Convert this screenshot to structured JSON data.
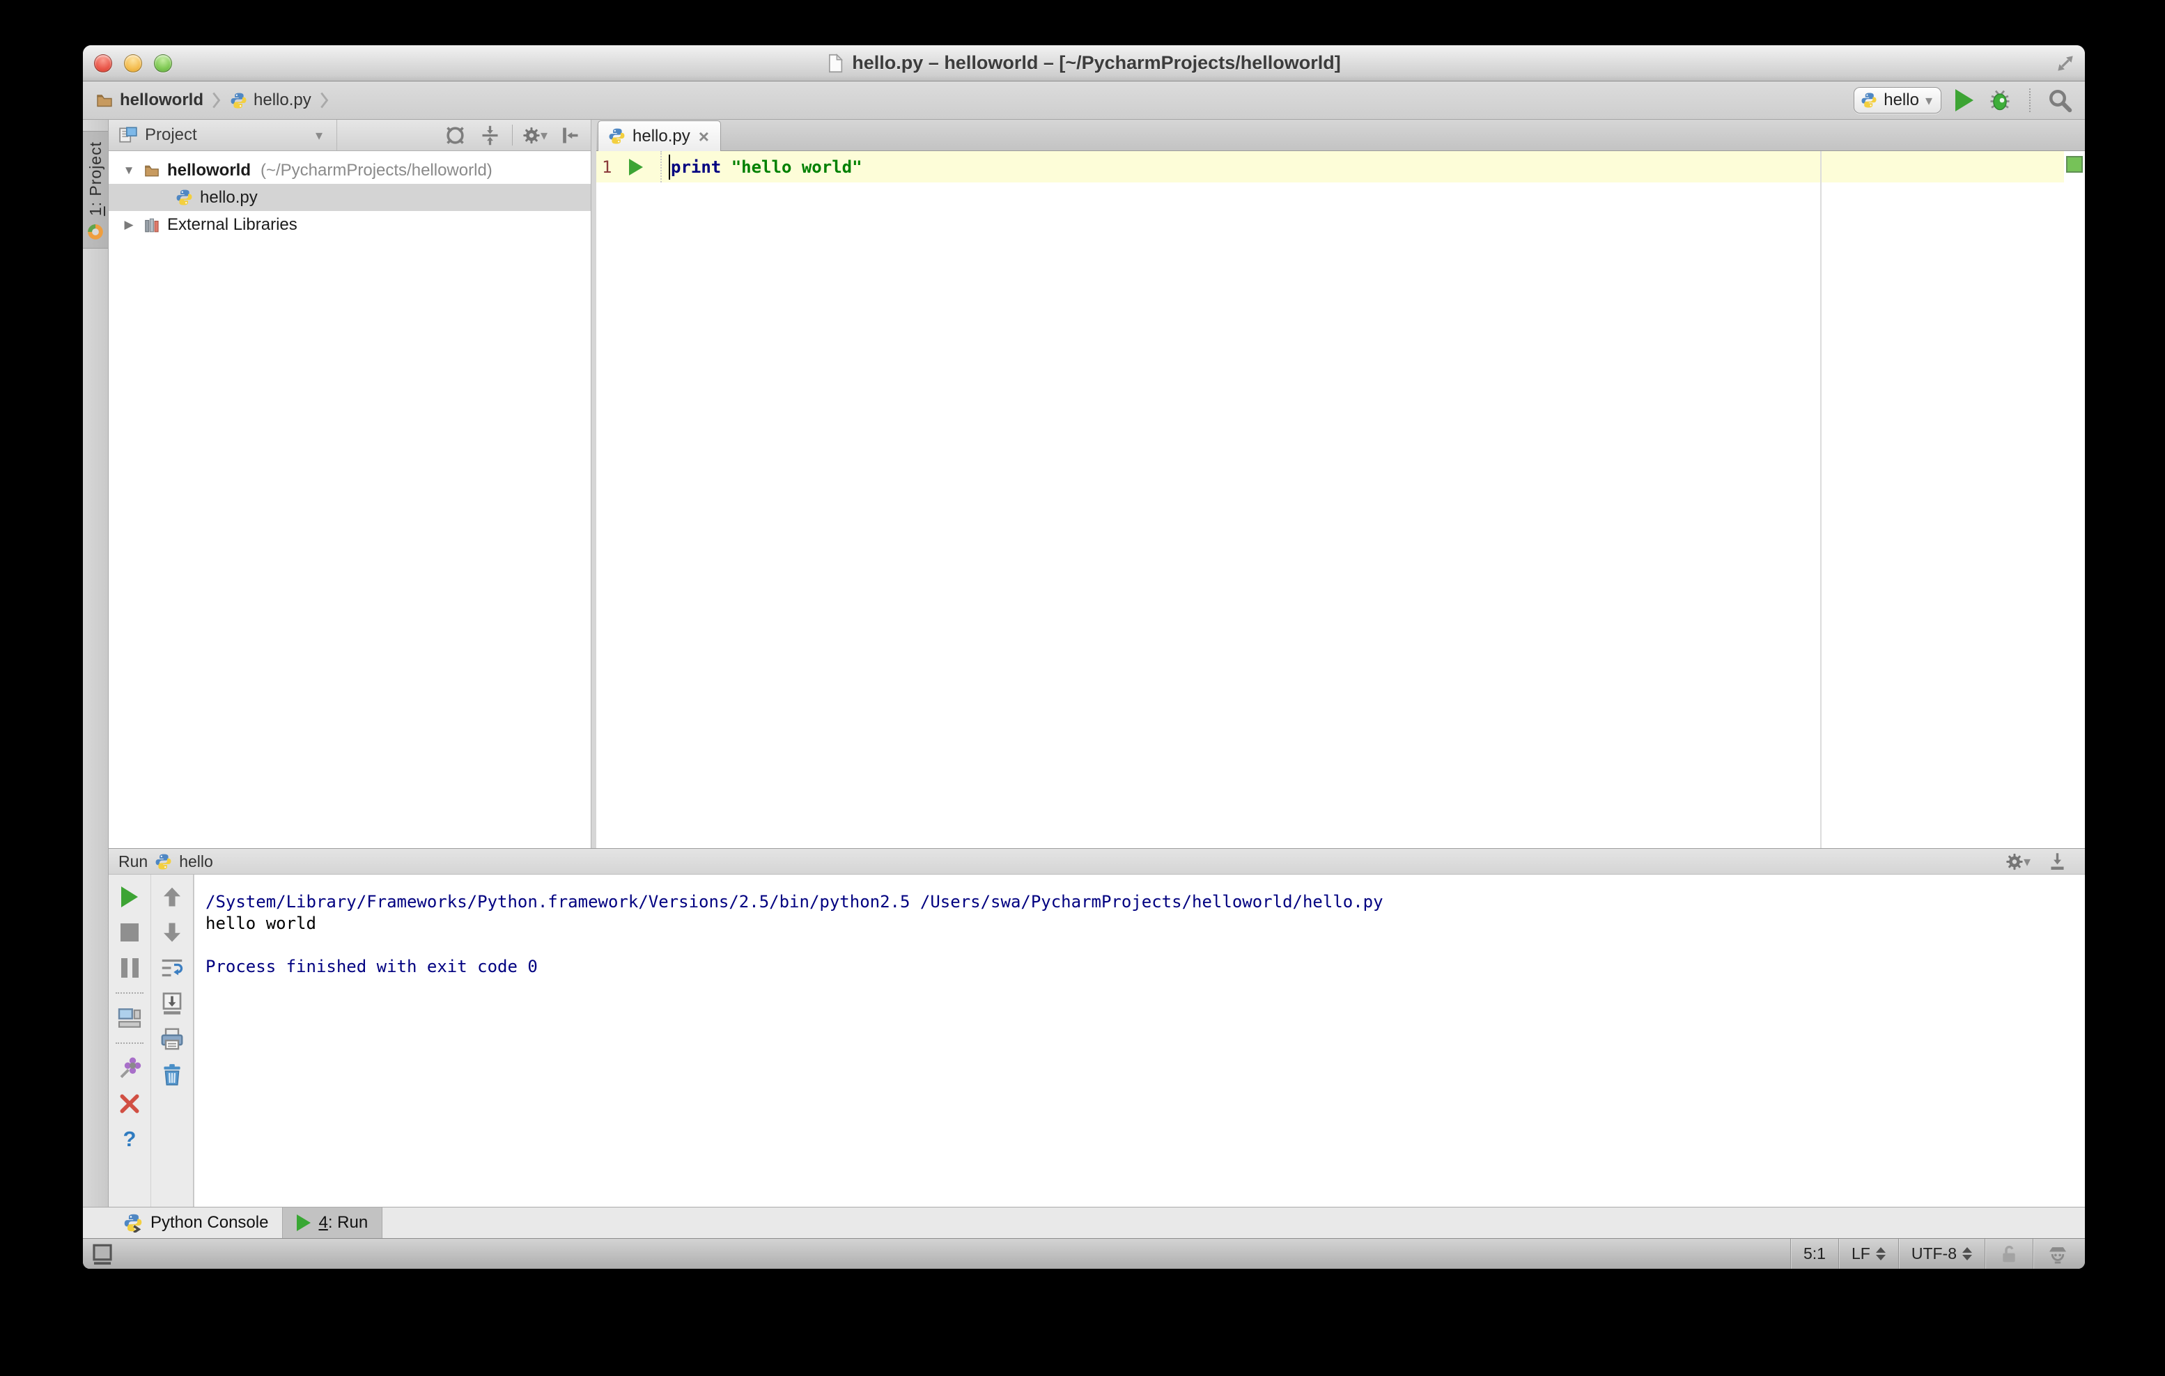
{
  "window": {
    "title": "hello.py – helloworld – [~/PycharmProjects/helloworld]"
  },
  "navbar": {
    "breadcrumb": {
      "project": "helloworld",
      "file": "hello.py"
    },
    "run_config": {
      "name": "hello"
    }
  },
  "tool_strip": {
    "project_button": {
      "num": "1",
      "label": ": Project"
    }
  },
  "project_panel": {
    "header_title": "Project",
    "tree": {
      "root_name": "helloworld",
      "root_path": "(~/PycharmProjects/helloworld)",
      "file_name": "hello.py",
      "libraries_label": "External Libraries"
    }
  },
  "editor": {
    "tab_label": "hello.py",
    "line_number": "1",
    "code_keyword": "print",
    "code_string": "\"hello world\""
  },
  "run_panel": {
    "title": "Run",
    "config_name": "hello",
    "console": [
      {
        "text": "/System/Library/Frameworks/Python.framework/Versions/2.5/bin/python2.5 /Users/swa/PycharmProjects/helloworld/hello.py"
      },
      {
        "text": "hello world"
      },
      {
        "text": ""
      },
      {
        "text": "Process finished with exit code 0"
      }
    ]
  },
  "bottom_bar": {
    "python_console_label": "Python Console",
    "run_tab": {
      "num": "4",
      "label": ": Run"
    }
  },
  "status_bar": {
    "caret_position": "5:1",
    "line_separator": "LF",
    "encoding": "UTF-8"
  },
  "icons": {
    "dropdown": "▾",
    "tree_expanded": "▼",
    "tree_collapsed": "▶",
    "tab_close": "×",
    "help": "?"
  },
  "colors": {
    "keyword": "#000080",
    "string": "#008000",
    "console_system": "#000080",
    "console_stdout": "#000000",
    "current_line_bg": "#fdfdd8",
    "run_green": "#3da434",
    "indicator_green": "#76c258",
    "line_number": "#8b3a3a"
  }
}
